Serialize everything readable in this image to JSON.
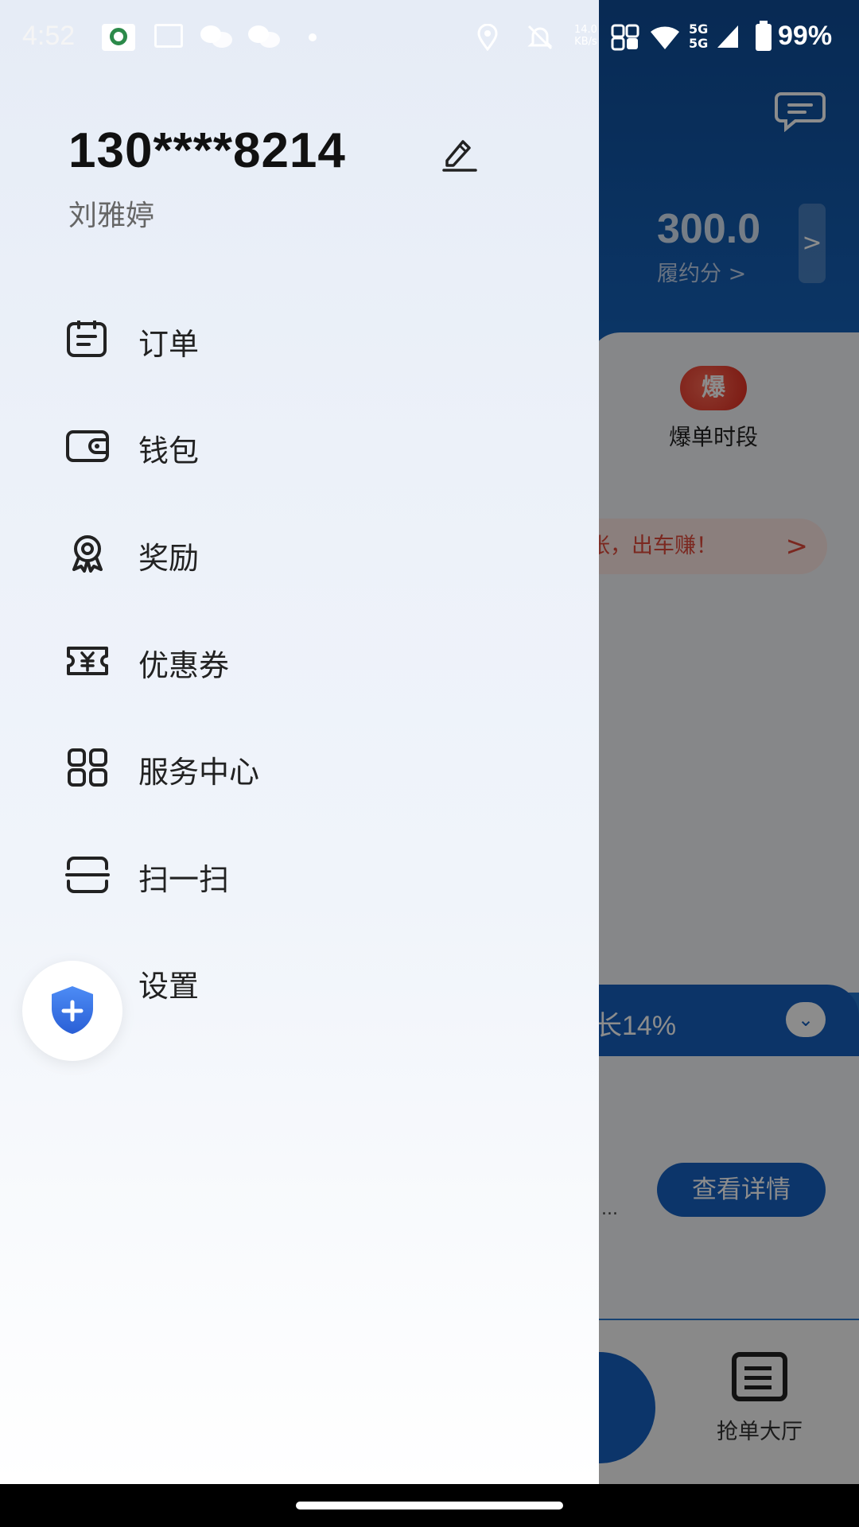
{
  "status_bar": {
    "time": "4:52",
    "network_speed_value": "14.0",
    "network_speed_unit": "KB/s",
    "network_type_top": "5G",
    "network_type_bottom": "5G",
    "battery": "99%",
    "icons": [
      "app-notification-icon",
      "message-icon",
      "wechat-icon",
      "wechat-icon",
      "dot-icon",
      "location-icon",
      "mute-icon",
      "nfc-icon",
      "wifi-icon",
      "signal-icon",
      "battery-icon"
    ]
  },
  "drawer": {
    "phone": "130****8214",
    "name": "刘雅婷",
    "menu": [
      {
        "label": "订单",
        "icon": "order-icon"
      },
      {
        "label": "钱包",
        "icon": "wallet-icon"
      },
      {
        "label": "奖励",
        "icon": "reward-icon"
      },
      {
        "label": "优惠券",
        "icon": "coupon-icon"
      },
      {
        "label": "服务中心",
        "icon": "service-center-icon"
      },
      {
        "label": "扫一扫",
        "icon": "scan-icon"
      },
      {
        "label": "设置",
        "icon": "settings-icon"
      }
    ],
    "fab_icon": "shield-plus-icon"
  },
  "background_app": {
    "score_value": "300.0",
    "score_label": "履约分 >",
    "score_arrow": ">",
    "hot_badge": "爆",
    "hot_label": "爆单时段",
    "promo_text": "张，出车赚！",
    "promo_arrow": ">",
    "rate_text": "长14%",
    "detail_button": "查看详情",
    "ellipsis": "...",
    "hall_label": "抢单大厅"
  },
  "colors": {
    "accent_blue": "#1661c2",
    "header_blue": "#0f4d99",
    "promo_red": "#e0493b"
  }
}
